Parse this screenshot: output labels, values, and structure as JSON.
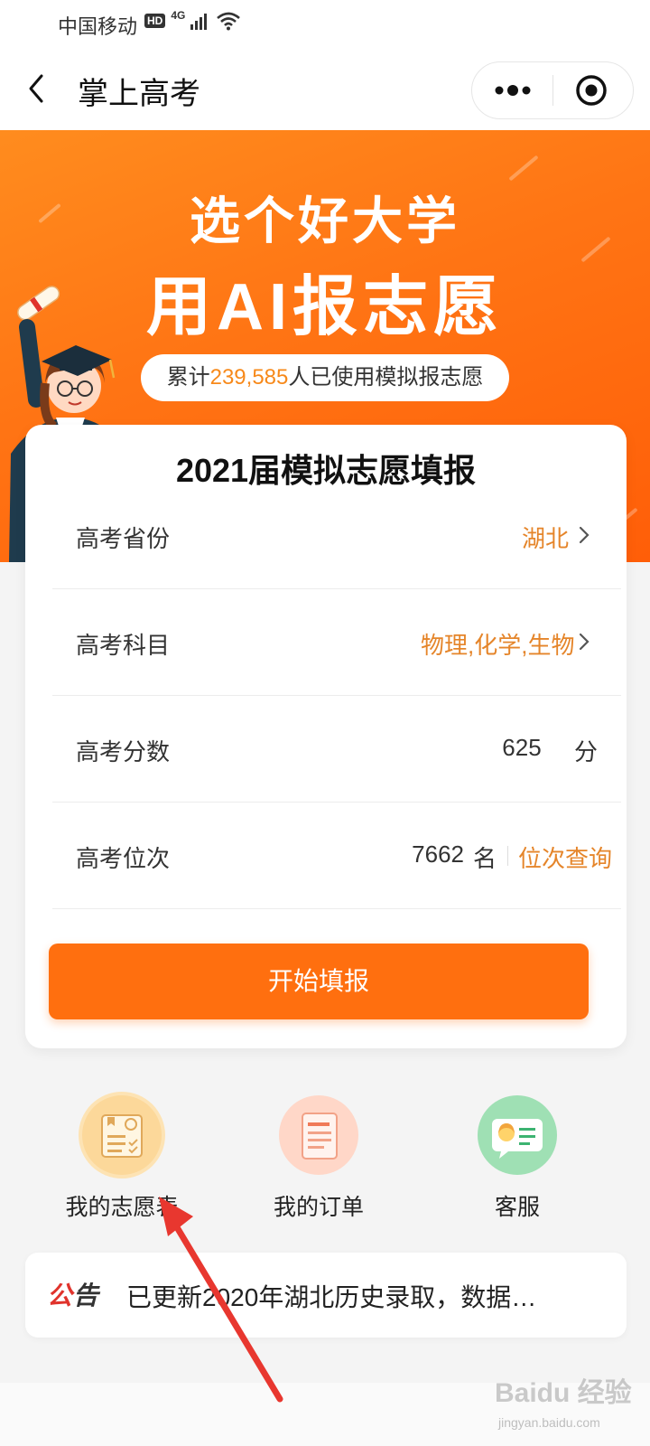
{
  "status_bar": {
    "carrier": "中国移动",
    "hd": "HD",
    "network": "4G"
  },
  "nav": {
    "title": "掌上高考"
  },
  "banner": {
    "line1": "选个好大学",
    "line2": "用AI报志愿",
    "counter_prefix": "累计",
    "counter_value": "239,585",
    "counter_suffix": "人已使用模拟报志愿"
  },
  "form": {
    "title": "2021届模拟志愿填报",
    "province_label": "高考省份",
    "province_value": "湖北",
    "subjects_label": "高考科目",
    "subjects_value": "物理,化学,生物",
    "score_label": "高考分数",
    "score_value": "625",
    "score_unit": "分",
    "rank_label": "高考位次",
    "rank_value": "7662",
    "rank_unit": "名",
    "rank_query": "位次查询",
    "start_button": "开始填报"
  },
  "shortcuts": [
    {
      "label": "我的志愿表",
      "icon": "application-form-icon"
    },
    {
      "label": "我的订单",
      "icon": "order-document-icon"
    },
    {
      "label": "客服",
      "icon": "customer-service-icon"
    }
  ],
  "notice": {
    "tag_part1": "公",
    "tag_part2": "告",
    "text": "已更新2020年湖北历史录取，数据…"
  },
  "watermark": {
    "main": "Baidu 经验",
    "sub": "jingyan.baidu.com"
  },
  "colors": {
    "accent": "#ff6f0f",
    "highlight": "#e5852a",
    "notice_red": "#e0332c"
  }
}
